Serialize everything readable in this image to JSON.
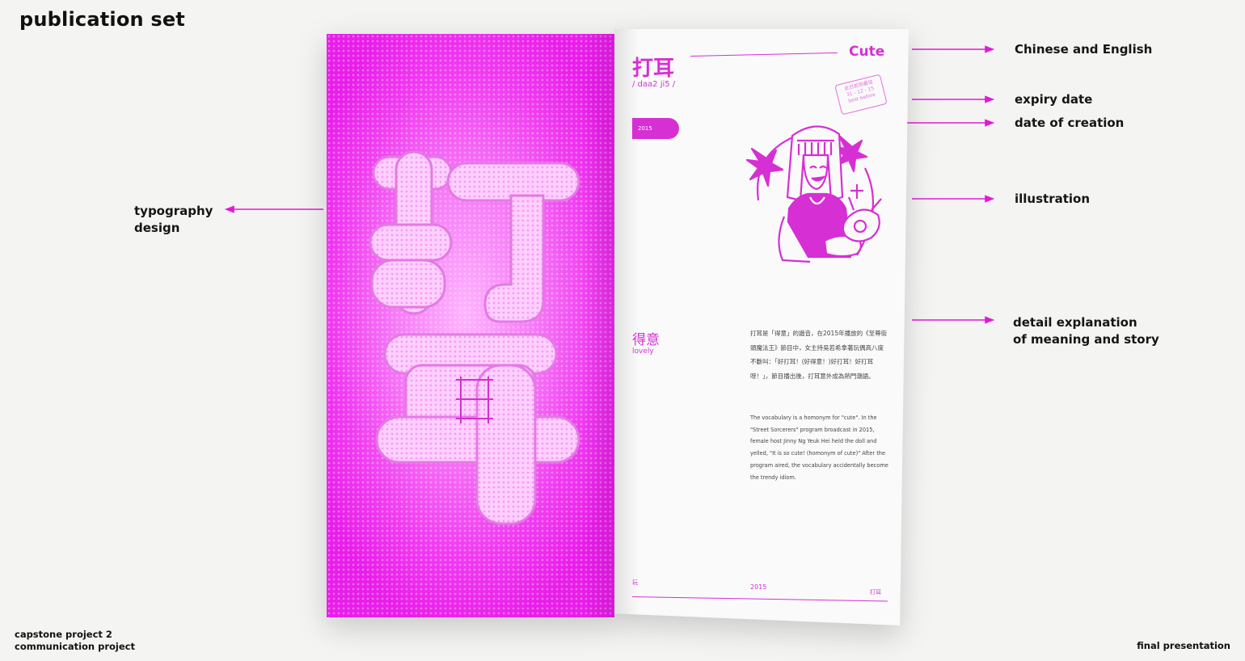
{
  "header": {
    "title": "publication set"
  },
  "footer": {
    "left_line1": "capstone project 2",
    "left_line2": "communication project",
    "right": "final presentation"
  },
  "callouts": {
    "chinese_english": "Chinese and English",
    "expiry_date": "expiry date",
    "date_of_creation": "date of creation",
    "illustration": "illustration",
    "detail_line1": "detail explanation",
    "detail_line2": "of meaning and story",
    "typography_line1": "typography",
    "typography_line2": "design"
  },
  "publication": {
    "accent_color": "#d62fd4",
    "cover_chars": [
      "打",
      "耳"
    ],
    "word_cn": "打耳",
    "word_en": "Cute",
    "jyutping": "/ daa2 ji5 /",
    "date_pill": "2015",
    "stamp_line1": "此日前到最佳",
    "stamp_line2": "31 - 12 - 15",
    "stamp_line3": "best before",
    "meaning_cn": "得意",
    "meaning_en": "lovely",
    "body_cn": "打耳是「得意」的諧音，在2015年播放的《至尊街頭魔法王》節目中，女主持吳若希拿著玩偶高八度不斷叫：「好打耳！(好得意！)好打耳！好打耳呀！」，節目播出後，打耳意外成為熱門潮語。",
    "body_en": "The vocabulary is a homonym for \"cute\". In the \"Street Sorcerers\" program broadcast in 2015, female host Jinny Ng Yeuk Hei held the doll and yelled, \"It is so cute! (homonym of cute)\" After the program aired, the vocabulary accidentally become the trendy idiom.",
    "footer_left": "玩",
    "footer_mid": "2015",
    "footer_right": "打耳"
  }
}
